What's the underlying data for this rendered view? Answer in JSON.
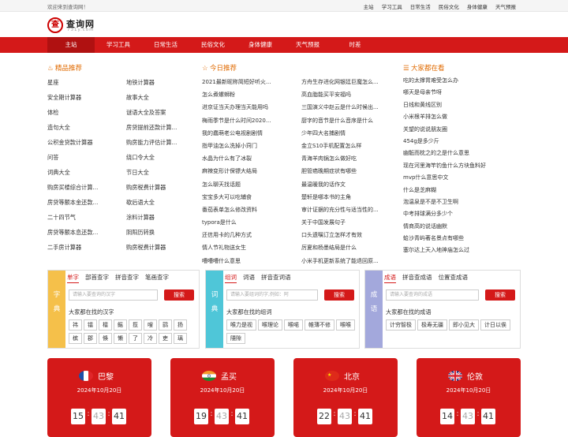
{
  "topbar": {
    "welcome": "欢迎来到查询网！",
    "links": [
      "主站",
      "学习工具",
      "日常生活",
      "民俗文化",
      "身体健康",
      "天气预报"
    ]
  },
  "logo": {
    "mark": "查",
    "title": "查询网",
    "domain": "731y.com"
  },
  "nav": [
    "主站",
    "学习工具",
    "日常生活",
    "民俗文化",
    "身体健康",
    "天气预报",
    "时差"
  ],
  "recommend": {
    "title": "精品推荐",
    "rows": [
      [
        "星座",
        "地铁计算器"
      ],
      [
        "安全期计算器",
        "故事大全"
      ],
      [
        "体检",
        "谜语大全及答案"
      ],
      [
        "造句大全",
        "房贷提前还款计算..."
      ],
      [
        "公积金贷款计算器",
        "购房能力评估计算..."
      ],
      [
        "问答",
        "绕口令大全"
      ],
      [
        "词典大全",
        "节日大全"
      ],
      [
        "购房买楼综合计算...",
        "购房税费计算器"
      ],
      [
        "房贷等额本金还款...",
        "歇后语大全"
      ],
      [
        "二十四节气",
        "涂料计算器"
      ],
      [
        "房贷等额本息还款...",
        "阴阳历转换"
      ],
      [
        "二手房计算器",
        "购房税费计算器"
      ]
    ]
  },
  "today": {
    "title": "今日推荐",
    "rows": [
      [
        "2021最新昵称简短好听火...",
        "方舟生存进化网银廷巨魔怎么..."
      ],
      [
        "怎么煮螺蛳粉",
        "高血脂能买平安福吗"
      ],
      [
        "进京证当天办理当天能用吗",
        "三国演义中赵云是什么时候出..."
      ],
      [
        "梅雨季节是什么时间2020...",
        "厨字的音节是什么音序是什么"
      ],
      [
        "我的蠢萌老公电视剧剧情",
        "少年四大名捕剧情"
      ],
      [
        "指甲油怎么洗掉小窍门",
        "金立S10手机配置怎么样"
      ],
      [
        "水晶为什么有了冰裂",
        "青海羊肉锅怎么做好吃"
      ],
      [
        "麻辣变形计保镖大结局",
        "胆管癌晚期症状有哪些"
      ],
      [
        "怎么聊天找话题",
        "最温暖我的话作文"
      ],
      [
        "宝宝多大可以吃辅食",
        "楚轩是哪本书的主角"
      ],
      [
        "番茄表单怎么修改资料",
        "审计证据的充分性与适当性的..."
      ],
      [
        "typora是什么",
        "关于中国发展句子"
      ],
      [
        "还信用卡的几种方式",
        "口头遗嘱订立怎样才有效"
      ],
      [
        "情人节礼物送女生",
        "厉夏和杨墨结局是什么"
      ],
      [
        "嘈嘈嘈什么意思",
        "小米手机更新系统了能退回原..."
      ]
    ]
  },
  "popular": {
    "title": "大家都在看",
    "items": [
      "吃的太撑胃难受怎么办",
      "哪天是母亲节呀",
      "日线和黄线区别",
      "小米根羊排怎么做",
      "关望的说说朋友圈",
      "454g是多少斤",
      "幽骶而枕之的之是什么意思",
      "现在河里海竿钓鱼什么方块鱼料好",
      "mvp什么意思中文",
      "什么是芝麻糊",
      "泡温泉是不是不卫生啊",
      "中考排球满分多少个",
      "情商高的说话幽默",
      "蛤沙青屿著名景点有哪些",
      "塞尔达上天入地神庙怎么过"
    ]
  },
  "panels": [
    {
      "side": [
        "字",
        "典"
      ],
      "tabs": [
        "单字",
        "部首查字",
        "拼音查字",
        "笔画查字"
      ],
      "placeholder": "请输入要查询的汉字",
      "button": "搜索",
      "label": "大家都在找的汉字",
      "chips": [
        "祎",
        "镭",
        "檑",
        "鳐",
        "揽",
        "嗖",
        "鹞",
        "扬",
        "槟",
        "郡",
        "倏",
        "懒",
        "了",
        "冷",
        "吏",
        "璃"
      ],
      "color": "#f5c04a"
    },
    {
      "side": [
        "词",
        "典"
      ],
      "tabs": [
        "组词",
        "词语",
        "拼音查词语"
      ],
      "placeholder": "请输入要组词的字,例如：阿",
      "button": "搜索",
      "label": "大家都在找的组词",
      "chips": [
        "喉力是视",
        "喉理论",
        "喉喏",
        "帷薄不修",
        "喉喉",
        "隱隙"
      ],
      "color": "#4fc6d8"
    },
    {
      "side": [
        "成",
        "语"
      ],
      "tabs": [
        "成语",
        "拼音查成语",
        "位置查成语"
      ],
      "placeholder": "请输入要查询的成语",
      "button": "搜索",
      "label": "大家都在找的成语",
      "chips": [
        "计穷智极",
        "极寿无疆",
        "即小见大",
        "计日以俟"
      ],
      "color": "#a3a8dc"
    }
  ],
  "clocks": [
    {
      "city": "巴黎",
      "flag": "fr-flag-icon",
      "date": "2024年10月20日",
      "h": "15",
      "m": "43",
      "s": "41"
    },
    {
      "city": "孟买",
      "flag": "in-flag-icon",
      "date": "2024年10月20日",
      "h": "19",
      "m": "43",
      "s": "41"
    },
    {
      "city": "北京",
      "flag": "cn-flag-icon",
      "date": "2024年10月20日",
      "h": "22",
      "m": "43",
      "s": "41"
    },
    {
      "city": "伦敦",
      "flag": "gb-flag-icon",
      "date": "2024年10月20日",
      "h": "14",
      "m": "43",
      "s": "41"
    }
  ],
  "colors": {
    "brand": "#d41919",
    "accent": "#e06a00"
  }
}
